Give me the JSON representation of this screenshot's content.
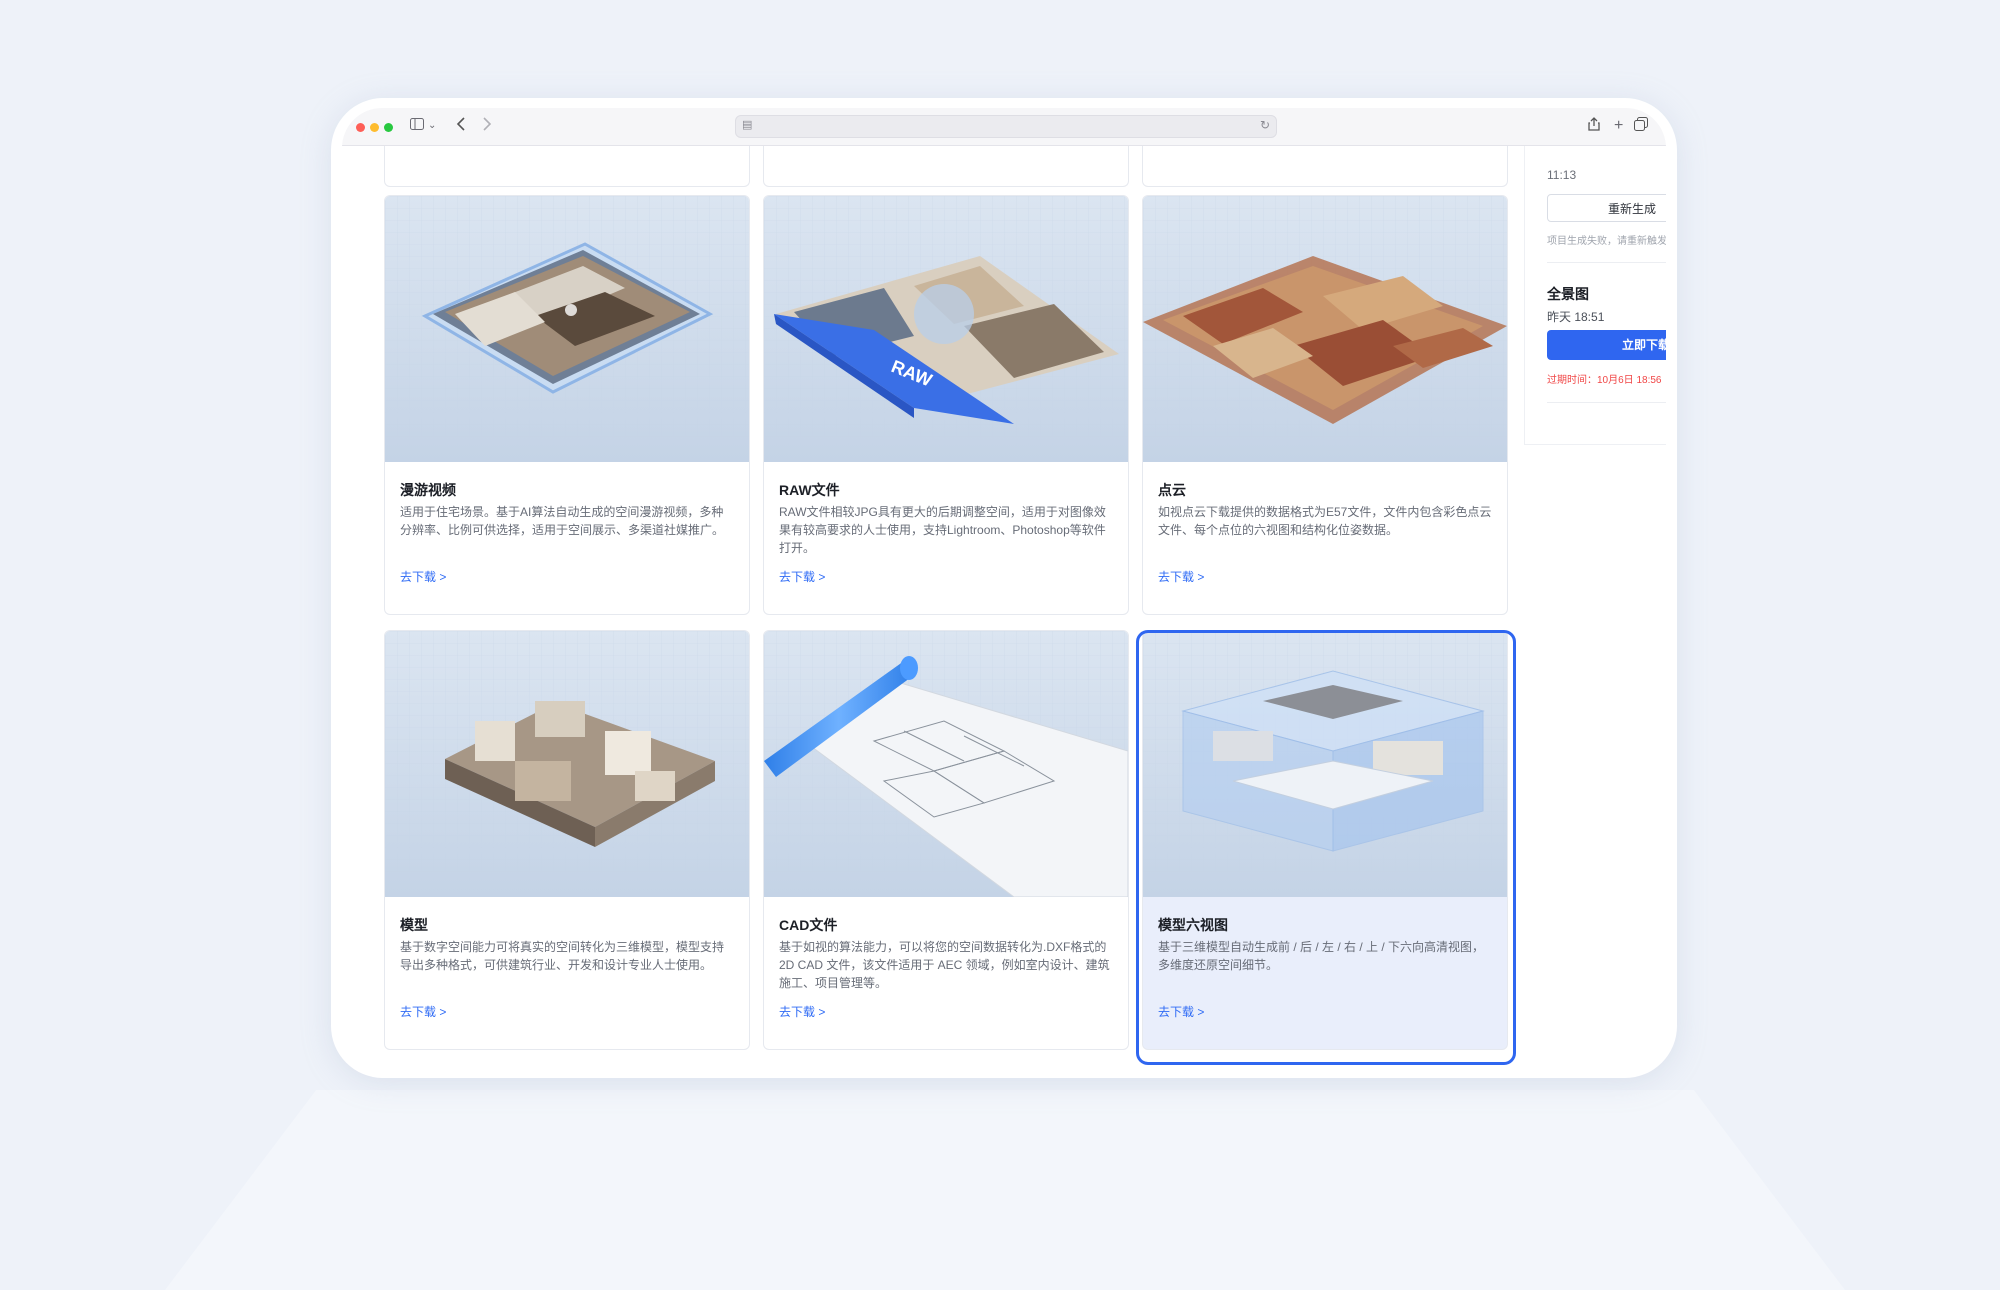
{
  "browser": {
    "url_icon": "page-icon",
    "reload_icon": "reload-icon"
  },
  "cards": [
    {
      "title": "漫游视频",
      "desc": "适用于住宅场景。基于AI算法自动生成的空间漫游视频，多种分辨率、比例可供选择，适用于空间展示、多渠道社媒推广。",
      "link": "去下载 >"
    },
    {
      "title": "RAW文件",
      "desc": "RAW文件相较JPG具有更大的后期调整空间，适用于对图像效果有较高要求的人士使用，支持Lightroom、Photoshop等软件打开。",
      "link": "去下载 >",
      "badge": "RAW"
    },
    {
      "title": "点云",
      "desc": "如视点云下载提供的数据格式为E57文件，文件内包含彩色点云文件、每个点位的六视图和结构化位姿数据。",
      "link": "去下载 >"
    },
    {
      "title": "模型",
      "desc": "基于数字空间能力可将真实的空间转化为三维模型，模型支持导出多种格式，可供建筑行业、开发和设计专业人士使用。",
      "link": "去下载 >"
    },
    {
      "title": "CAD文件",
      "desc": "基于如视的算法能力，可以将您的空间数据转化为.DXF格式的 2D CAD 文件，该文件适用于 AEC 领域，例如室内设计、建筑施工、项目管理等。",
      "link": "去下载 >"
    },
    {
      "title": "模型六视图",
      "desc": "基于三维模型自动生成前 / 后 / 左 / 右 / 上 / 下六向高清视图，多维度还原空间细节。",
      "link": "去下载 >"
    }
  ],
  "panel": {
    "time1": "11:13",
    "regen_label": "重新生成",
    "fail_note": "项目生成失败，请重新触发",
    "title": "全景图",
    "time2": "昨天 18:51",
    "download_label": "立即下载",
    "expire": "过期时间：10月6日 18:56"
  },
  "colors": {
    "accent": "#2f66f0",
    "danger": "#f04646"
  }
}
